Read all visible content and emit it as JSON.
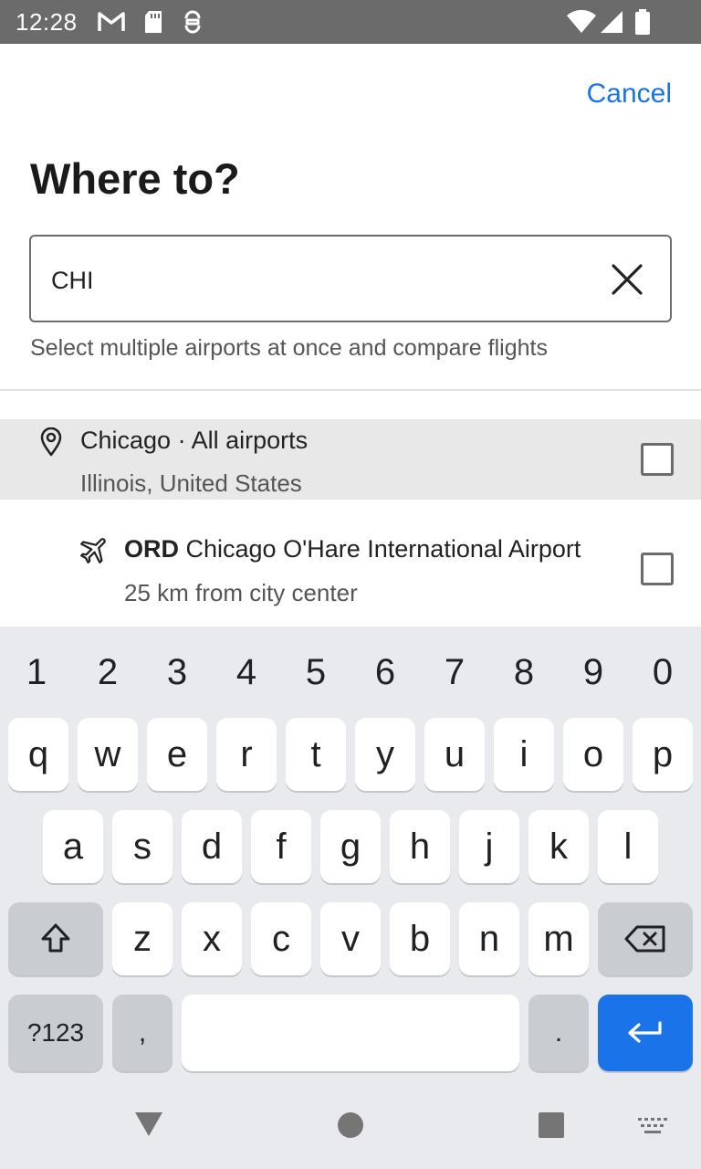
{
  "status_bar": {
    "time": "12:28",
    "icons": [
      "gmail-icon",
      "sd-card-icon",
      "vpn-key-icon",
      "wifi-icon",
      "signal-icon",
      "battery-icon"
    ]
  },
  "header": {
    "cancel_label": "Cancel",
    "title": "Where to?"
  },
  "search": {
    "value": "CHI",
    "hint": "Select multiple airports at once and compare flights"
  },
  "results": [
    {
      "icon": "location-pin-icon",
      "name": "Chicago · All airports",
      "detail": "Illinois, United States",
      "checked": false
    },
    {
      "icon": "airplane-icon",
      "code": "ORD",
      "name": "Chicago O'Hare International Airport",
      "detail": "25 km from city center",
      "checked": false
    }
  ],
  "keyboard": {
    "numbers": [
      "1",
      "2",
      "3",
      "4",
      "5",
      "6",
      "7",
      "8",
      "9",
      "0"
    ],
    "row1": [
      "q",
      "w",
      "e",
      "r",
      "t",
      "y",
      "u",
      "i",
      "o",
      "p"
    ],
    "row2": [
      "a",
      "s",
      "d",
      "f",
      "g",
      "h",
      "j",
      "k",
      "l"
    ],
    "row3": [
      "z",
      "x",
      "c",
      "v",
      "b",
      "n",
      "m"
    ],
    "symbols_label": "?123",
    "comma": ",",
    "period": ".",
    "accent_color": "#1a73e8"
  }
}
